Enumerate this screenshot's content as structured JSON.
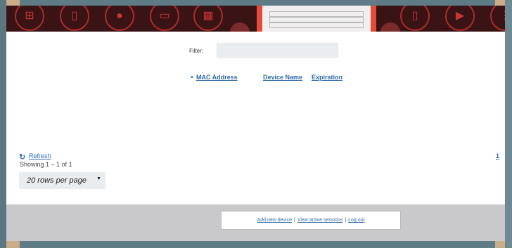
{
  "filter": {
    "label": "Filter:",
    "value": "",
    "placeholder": ""
  },
  "table": {
    "columns": [
      "MAC Address",
      "Device Name",
      "Expiration"
    ],
    "sort_indicator": "▲"
  },
  "refresh": {
    "label": "Refresh"
  },
  "showing": "Showing 1 – 1 of 1",
  "pagination": {
    "current": "1"
  },
  "rows_per_page": {
    "selected": "20 rows per page"
  },
  "footer": {
    "links": [
      "Add new device",
      "View active sessions",
      "Log out"
    ],
    "separator": "|"
  },
  "banner": {
    "icons": [
      "tv-box-icon",
      "speaker-icon",
      "microphone-icon",
      "monitor-icon",
      "game-device-icon",
      "keyboard-icon",
      "speaker-icon",
      "media-player-icon",
      "grid-icon"
    ],
    "accent_color": "#b02a2a",
    "background_color": "#3a1414"
  },
  "colors": {
    "link": "#2c6aa8",
    "footer_bg": "#c9c9cb",
    "frame": "#c8ad88"
  }
}
